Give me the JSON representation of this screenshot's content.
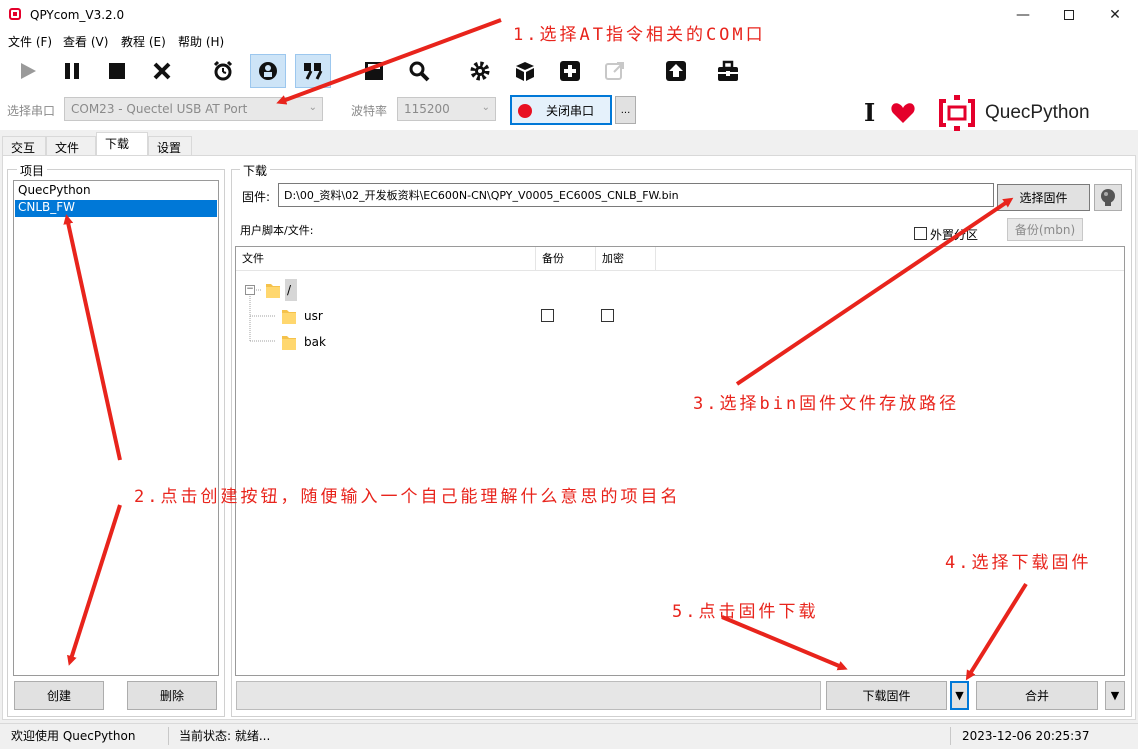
{
  "window": {
    "title": "QPYcom_V3.2.0",
    "min_icon": "minimize-icon",
    "max_icon": "maximize-icon",
    "close_icon": "close-icon"
  },
  "menu": [
    "文件 (F)",
    "查看 (V)",
    "教程 (E)",
    "帮助 (H)"
  ],
  "toolbar": {
    "icons": [
      "play-icon",
      "pause-icon",
      "stop-icon",
      "clear-icon",
      "alarm-icon",
      "hex-view-icon",
      "quote-icon",
      "save-log-icon",
      "search-icon",
      "settings-icon",
      "package-icon",
      "add-icon",
      "external-link-icon",
      "upload-icon",
      "toolbox-icon"
    ]
  },
  "port": {
    "label": "选择串口",
    "value": "COM23 - Quectel USB AT Port",
    "baud_label": "波特率",
    "baud_value": "115200",
    "close_button": "关闭串口",
    "more_button": "...",
    "status_color": "#e81123"
  },
  "brand": {
    "name": "QuecPython",
    "color": "#e4002b"
  },
  "tabs": [
    "交互",
    "文件",
    "下载",
    "设置"
  ],
  "selected_tab": "下载",
  "project": {
    "title": "项目",
    "items": [
      "QuecPython",
      "CNLB_FW"
    ],
    "selected": "CNLB_FW",
    "create_button": "创建",
    "delete_button": "删除"
  },
  "download": {
    "title": "下载",
    "firmware_label": "固件:",
    "firmware_path": "D:\\00_资料\\02_开发板资料\\EC600N-CN\\QPY_V0005_EC600S_CNLB_FW.bin",
    "choose_firmware_button": "选择固件",
    "backup_mbn_button": "备份(mbn)",
    "user_scripts_label": "用户脚本/文件:",
    "external_partition_label": "外置分区",
    "columns": [
      "文件",
      "备份",
      "加密"
    ],
    "tree": [
      {
        "name": "/",
        "level": 0
      },
      {
        "name": "usr",
        "level": 1
      },
      {
        "name": "bak",
        "level": 1
      }
    ],
    "download_button": "下载固件",
    "dropdown_arrow": "▼",
    "merge_button": "合并"
  },
  "statusbar": {
    "welcome": "欢迎使用 QuecPython",
    "state": "当前状态: 就绪...",
    "datetime": "2023-12-06 20:25:37"
  },
  "annotations": {
    "note1": "1.选择AT指令相关的COM口",
    "note2": "2.点击创建按钮，随便输入一个自己能理解什么意思的项目名",
    "note3": "3.选择bin固件文件存放路径",
    "note4": "4.选择下载固件",
    "note5": "5.点击固件下载",
    "color": "#e8241c"
  }
}
